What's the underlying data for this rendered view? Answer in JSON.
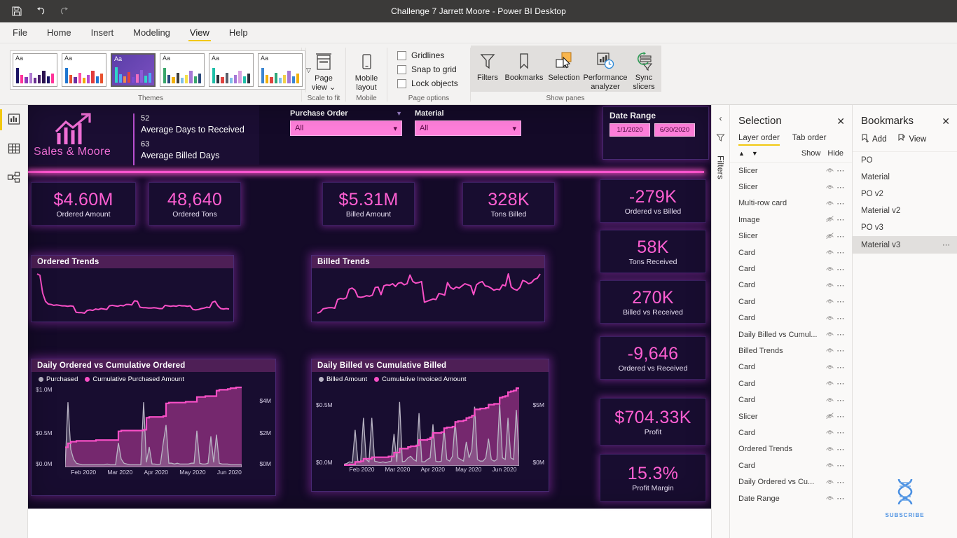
{
  "titlebar": {
    "title": "Challenge 7 Jarrett Moore - Power BI Desktop",
    "icons": [
      "save-icon",
      "undo-icon",
      "redo-icon"
    ]
  },
  "ribbon": {
    "tabs": [
      "File",
      "Home",
      "Insert",
      "Modeling",
      "View",
      "Help"
    ],
    "active_tab": "View",
    "groups": {
      "themes_label": "Themes",
      "scale_label": "Scale to fit",
      "mobile_label": "Mobile",
      "page_options_label": "Page options",
      "show_panes_label": "Show panes"
    },
    "buttons": {
      "page_view_line1": "Page",
      "page_view_line2": "view ⌄",
      "mobile_layout_line1": "Mobile",
      "mobile_layout_line2": "layout",
      "filters": "Filters",
      "bookmarks": "Bookmarks",
      "selection": "Selection",
      "perf_line1": "Performance",
      "perf_line2": "analyzer",
      "sync_line1": "Sync",
      "sync_line2": "slicers"
    },
    "checkboxes": [
      {
        "label": "Gridlines",
        "checked": false
      },
      {
        "label": "Snap to grid",
        "checked": false
      },
      {
        "label": "Lock objects",
        "checked": false
      }
    ],
    "theme_swatches": [
      {
        "name": "classic",
        "selected": false,
        "colors": [
          "#1b1464",
          "#ff3399",
          "#8a3ab9",
          "#b07ad1",
          "#6a2f8f",
          "#4a1f6b",
          "#2b1250"
        ]
      },
      {
        "name": "accessible-default",
        "selected": false,
        "colors": [
          "#1f77d0",
          "#e8522e",
          "#6b2fa0",
          "#ff4fa3",
          "#f2a900",
          "#b84ad1",
          "#e03c3c"
        ]
      },
      {
        "name": "executive",
        "selected": true,
        "colors": [
          "#2fd5c8",
          "#4ea7f5",
          "#f08a4b",
          "#e0433f",
          "#7b4bd4",
          "#f06ec0",
          "#8a5cd6"
        ]
      },
      {
        "name": "frontier",
        "selected": false,
        "colors": [
          "#3aa66b",
          "#2b4a7e",
          "#f2b10a",
          "#3d3d3d",
          "#7fc1ea",
          "#f5e04a",
          "#a678d6"
        ]
      },
      {
        "name": "innovate",
        "selected": false,
        "colors": [
          "#1fbfa8",
          "#2b2f3a",
          "#e0433f",
          "#5a5f6a",
          "#7fc1ea",
          "#a678d6",
          "#d8a0e0"
        ]
      },
      {
        "name": "bloom",
        "selected": false,
        "colors": [
          "#3b86d1",
          "#f2b10a",
          "#e0433f",
          "#2fa87a",
          "#7fc1ea",
          "#f2d04a",
          "#a678d6"
        ]
      }
    ]
  },
  "left_rail": {
    "items": [
      {
        "name": "report-view-icon",
        "label": "Report"
      },
      {
        "name": "data-view-icon",
        "label": "Data"
      },
      {
        "name": "model-view-icon",
        "label": "Model"
      }
    ],
    "active": "Report"
  },
  "report": {
    "brand": "Sales & Moore",
    "multi_row_card": [
      {
        "value": "52",
        "label": "Average Days to Received"
      },
      {
        "value": "63",
        "label": "Average Billed Days"
      }
    ],
    "slicers": [
      {
        "label": "Purchase Order",
        "value": "All"
      },
      {
        "label": "Material",
        "value": "All"
      }
    ],
    "date_range": {
      "title": "Date Range",
      "start": "1/1/2020",
      "end": "6/30/2020"
    },
    "kpis_top": [
      {
        "value": "$4.60M",
        "label": "Ordered Amount"
      },
      {
        "value": "48,640",
        "label": "Ordered Tons"
      },
      {
        "value": "$5.31M",
        "label": "Billed Amount"
      },
      {
        "value": "328K",
        "label": "Tons Billed"
      }
    ],
    "kpis_right": [
      {
        "value": "-279K",
        "label": "Ordered vs Billed"
      },
      {
        "value": "58K",
        "label": "Tons Received"
      },
      {
        "value": "270K",
        "label": "Billed vs Received"
      },
      {
        "value": "-9,646",
        "label": "Ordered vs Received"
      },
      {
        "value": "$704.33K",
        "label": "Profit"
      },
      {
        "value": "15.3%",
        "label": "Profit Margin"
      }
    ],
    "colors": {
      "background": "#140a28",
      "accent_pink": "#ff5fd2",
      "line_pink": "#f84fc6",
      "area_purple": "#8e3f9e",
      "grey_series": "#b9b4c4",
      "card_bg": "#180d30"
    }
  },
  "chart_data": [
    {
      "type": "line",
      "title": "Ordered Trends",
      "xlabel": "",
      "ylabel": "",
      "series": [
        {
          "name": "Ordered",
          "color": "#f84fc6",
          "values": [
            100,
            97,
            58,
            40,
            34,
            33,
            31,
            32,
            31,
            30,
            30,
            29,
            30,
            29,
            16,
            15,
            15,
            14,
            20,
            21,
            20,
            23,
            22,
            24,
            23,
            22,
            30,
            31,
            30,
            29,
            31,
            30,
            33,
            33,
            32,
            41,
            40,
            27,
            26,
            26,
            25,
            25,
            26,
            25,
            24,
            24,
            31,
            30,
            29,
            30,
            29,
            31,
            30,
            30,
            29,
            30,
            22,
            21,
            22,
            24,
            25,
            27,
            26,
            38,
            40,
            30,
            24,
            23,
            24,
            23
          ]
        }
      ]
    },
    {
      "type": "line",
      "title": "Billed Trends",
      "xlabel": "",
      "ylabel": "",
      "series": [
        {
          "name": "Billed",
          "color": "#f84fc6",
          "values": [
            8,
            10,
            16,
            17,
            18,
            18,
            17,
            33,
            35,
            34,
            36,
            52,
            54,
            50,
            38,
            37,
            38,
            40,
            39,
            41,
            55,
            56,
            42,
            58,
            60,
            59,
            62,
            57,
            63,
            64,
            60,
            62,
            78,
            66,
            63,
            64,
            66,
            28,
            30,
            32,
            34,
            33,
            44,
            43,
            41,
            64,
            55,
            52,
            56,
            54,
            58,
            62,
            60,
            58,
            42,
            60,
            64,
            66,
            58,
            57,
            54,
            50,
            52,
            51,
            60,
            58,
            80,
            56,
            52,
            50,
            55,
            68,
            66,
            62,
            64,
            70,
            72,
            80
          ]
        }
      ]
    },
    {
      "type": "area",
      "title": "Daily Ordered vs Cumulative Ordered",
      "legend": [
        "Purchased",
        "Cumulative Purchased Amount"
      ],
      "legend_position": "top",
      "x_ticks": [
        "Feb 2020",
        "Mar 2020",
        "Apr 2020",
        "May 2020",
        "Jun 2020"
      ],
      "y_left_ticks": [
        "$0.0M",
        "$0.5M",
        "$1.0M"
      ],
      "y_right_ticks": [
        "$0M",
        "$2M",
        "$4M"
      ],
      "ylim_left": [
        0,
        1000000
      ],
      "ylim_right": [
        0,
        4600000
      ],
      "series": [
        {
          "name": "Purchased",
          "color": "#b9b4c4",
          "axis": "left",
          "values": [
            0.02,
            0.8,
            0.22,
            0.1,
            0.05,
            0.04,
            0.03,
            0.03,
            0.03,
            0.03,
            0.03,
            0.03,
            0.03,
            0.03,
            0.03,
            0.04,
            0.03,
            0.03,
            0.03,
            0.3,
            0.1,
            0.05,
            0.04,
            0.03,
            0.03,
            0.03,
            0.03,
            0.03,
            0.8,
            0.06,
            0.25,
            0.04,
            0.04,
            0.03,
            0.04,
            0.3,
            0.52,
            0.05,
            0.05,
            0.04,
            0.05,
            0.04,
            0.04,
            0.04,
            0.04,
            0.05,
            0.05,
            0.45,
            0.05,
            0.04,
            0.04,
            0.05,
            0.38,
            0.06,
            0.4,
            0.05,
            0.04,
            0.04,
            0.04,
            0.03,
            0.03,
            0.03,
            0.03,
            0.03
          ]
        },
        {
          "name": "Cumulative Purchased Amount",
          "color": "#f84fc6",
          "axis": "right",
          "values": [
            0.25,
            0.3,
            0.32,
            0.32,
            0.33,
            0.33,
            0.33,
            0.33,
            0.33,
            0.33,
            0.33,
            0.34,
            0.34,
            0.34,
            0.34,
            0.34,
            0.34,
            0.34,
            0.34,
            0.45,
            0.46,
            0.46,
            0.46,
            0.46,
            0.46,
            0.46,
            0.46,
            0.46,
            0.47,
            0.62,
            0.63,
            0.63,
            0.63,
            0.63,
            0.63,
            0.64,
            0.8,
            0.81,
            0.81,
            0.81,
            0.81,
            0.81,
            0.81,
            0.82,
            0.82,
            0.82,
            0.82,
            0.88,
            0.88,
            0.88,
            0.89,
            0.89,
            0.89,
            0.89,
            0.96,
            0.97,
            0.97,
            0.97,
            0.98,
            0.99,
            0.99,
            1.0,
            1.0,
            1.0
          ]
        }
      ]
    },
    {
      "type": "area",
      "title": "Daily Billed vs Cumulative Billed",
      "legend": [
        "Billed Amount",
        "Cumulative Invoiced Amount"
      ],
      "legend_position": "top",
      "x_ticks": [
        "Feb 2020",
        "Mar 2020",
        "Apr 2020",
        "May 2020",
        "Jun 2020"
      ],
      "y_left_ticks": [
        "$0.0M",
        "$0.5M"
      ],
      "y_right_ticks": [
        "$0M",
        "$5M"
      ],
      "ylim_left": [
        0,
        600000
      ],
      "ylim_right": [
        0,
        5310000
      ],
      "series": [
        {
          "name": "Billed Amount",
          "color": "#b9b4c4",
          "axis": "left",
          "values": [
            0.02,
            0.03,
            0.05,
            0.04,
            0.45,
            0.06,
            0.05,
            0.6,
            0.08,
            0.05,
            0.6,
            0.06,
            0.05,
            0.04,
            0.05,
            0.04,
            0.05,
            0.06,
            0.4,
            0.05,
            0.8,
            0.05,
            0.06,
            0.1,
            0.12,
            0.08,
            0.06,
            0.66,
            0.05,
            0.05,
            0.08,
            0.1,
            0.52,
            0.06,
            0.05,
            0.06,
            0.46,
            0.08,
            0.06,
            0.12,
            0.56,
            0.1,
            0.08,
            0.06,
            0.3,
            0.1,
            0.2,
            0.74,
            0.08,
            0.06,
            0.06,
            0.1,
            0.34,
            0.08,
            0.06,
            0.08,
            0.78,
            0.1,
            0.08,
            0.6,
            0.1,
            0.08,
            0.7,
            0.1
          ]
        },
        {
          "name": "Cumulative Invoiced Amount",
          "color": "#f84fc6",
          "axis": "right",
          "values": [
            0.01,
            0.01,
            0.02,
            0.02,
            0.05,
            0.05,
            0.06,
            0.09,
            0.09,
            0.09,
            0.11,
            0.11,
            0.11,
            0.11,
            0.11,
            0.11,
            0.12,
            0.12,
            0.17,
            0.17,
            0.22,
            0.22,
            0.22,
            0.24,
            0.25,
            0.25,
            0.26,
            0.33,
            0.33,
            0.33,
            0.34,
            0.36,
            0.42,
            0.42,
            0.42,
            0.43,
            0.48,
            0.49,
            0.49,
            0.5,
            0.56,
            0.57,
            0.57,
            0.58,
            0.61,
            0.62,
            0.64,
            0.72,
            0.72,
            0.73,
            0.73,
            0.74,
            0.78,
            0.78,
            0.79,
            0.79,
            0.87,
            0.88,
            0.89,
            0.94,
            0.95,
            0.96,
            0.99,
            1.0
          ]
        }
      ]
    }
  ],
  "filters_rail": {
    "collapse_icon": "chevron-left-icon",
    "filter_icon": "filter-icon",
    "label": "Filters"
  },
  "selection_pane": {
    "title": "Selection",
    "close_icon": "close-icon",
    "tabs": [
      "Layer order",
      "Tab order"
    ],
    "active_tab": "Layer order",
    "move_up_icon": "triangle-up-icon",
    "move_down_icon": "triangle-down-icon",
    "show_label": "Show",
    "hide_label": "Hide",
    "layers": [
      {
        "name": "Slicer",
        "visible": true
      },
      {
        "name": "Slicer",
        "visible": true
      },
      {
        "name": "Multi-row card",
        "visible": true
      },
      {
        "name": "Image",
        "visible": false
      },
      {
        "name": "Slicer",
        "visible": false
      },
      {
        "name": "Card",
        "visible": true
      },
      {
        "name": "Card",
        "visible": true
      },
      {
        "name": "Card",
        "visible": true
      },
      {
        "name": "Card",
        "visible": true
      },
      {
        "name": "Card",
        "visible": true
      },
      {
        "name": "Daily Billed vs Cumul...",
        "visible": true
      },
      {
        "name": "Billed Trends",
        "visible": true
      },
      {
        "name": "Card",
        "visible": true
      },
      {
        "name": "Card",
        "visible": true
      },
      {
        "name": "Card",
        "visible": true
      },
      {
        "name": "Slicer",
        "visible": false
      },
      {
        "name": "Card",
        "visible": true
      },
      {
        "name": "Ordered Trends",
        "visible": true
      },
      {
        "name": "Card",
        "visible": true
      },
      {
        "name": "Daily Ordered vs Cu...",
        "visible": true
      },
      {
        "name": "Date Range",
        "visible": true
      }
    ]
  },
  "bookmarks_pane": {
    "title": "Bookmarks",
    "close_icon": "close-icon",
    "add_label": "Add",
    "view_label": "View",
    "items": [
      {
        "name": "PO",
        "selected": false
      },
      {
        "name": "Material",
        "selected": false
      },
      {
        "name": "PO v2",
        "selected": false
      },
      {
        "name": "Material v2",
        "selected": false
      },
      {
        "name": "PO v3",
        "selected": false
      },
      {
        "name": "Material v3",
        "selected": true
      }
    ],
    "watermark": {
      "icon": "dna-helix-icon",
      "label": "SUBSCRIBE",
      "color": "#4a90e2"
    }
  }
}
